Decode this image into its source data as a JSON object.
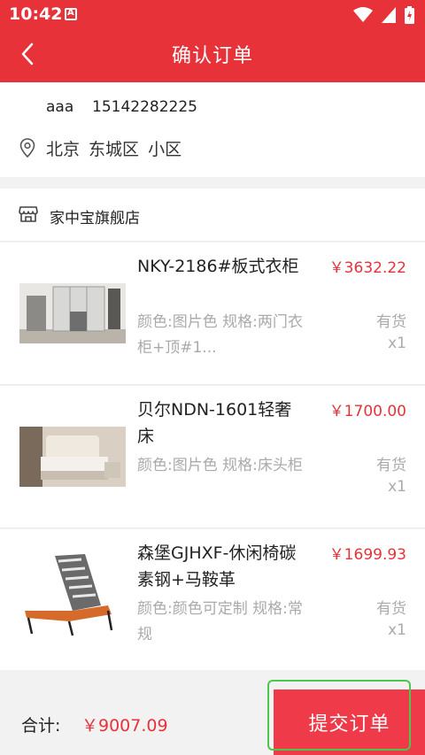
{
  "status_bar": {
    "time": "10:42"
  },
  "header": {
    "title": "确认订单"
  },
  "address": {
    "name": "aaa",
    "phone": "15142282225",
    "location": "北京 东城区 小区"
  },
  "store": {
    "name": "家中宝旗舰店"
  },
  "items": [
    {
      "name": "NKY-2186#板式衣柜",
      "spec": "颜色:图片色  规格:两门衣柜+顶#1...",
      "price": "￥3632.22",
      "stock": "有货",
      "qty": "x1"
    },
    {
      "name": "贝尔NDN-1601轻奢床",
      "spec": "颜色:图片色  规格:床头柜",
      "price": "￥1700.00",
      "stock": "有货",
      "qty": "x1"
    },
    {
      "name": "森堡GJHXF-休闲椅碳素钢+马鞍革",
      "spec": "颜色:颜色可定制  规格:常规",
      "price": "￥1699.93",
      "stock": "有货",
      "qty": "x1"
    }
  ],
  "footer": {
    "total_label": "合计:",
    "total_value": "￥9007.09",
    "submit_label": "提交订单"
  },
  "colors": {
    "brand": "#e8323a",
    "submit": "#ef3a4a",
    "focus": "#4cc64c"
  }
}
